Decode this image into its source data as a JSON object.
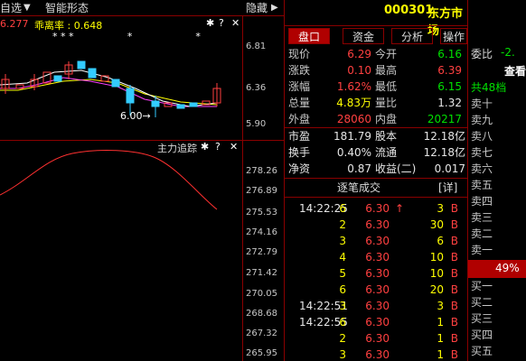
{
  "topbar": {
    "select_label": "自选",
    "stock_name_short": "智能形态",
    "hide_label": "隐藏",
    "ind_line": "6.277",
    "ind_name": "乖离率 : 0.648",
    "stars": "* * *                 *                    *",
    "btn_gear": "✱",
    "btn_help": "?",
    "btn_close": "✕"
  },
  "k_axis": {
    "t1": "6.81",
    "t2": "6.36",
    "t3": "5.90",
    "low_label": "6.00→"
  },
  "indicator": {
    "title": "主力追踪",
    "ticks": [
      "278.26",
      "276.89",
      "275.53",
      "274.16",
      "272.79",
      "271.42",
      "270.05",
      "268.68",
      "267.32",
      "265.95"
    ]
  },
  "header": {
    "code": "000301",
    "name": "东方市场"
  },
  "tabs": [
    "盘口",
    "资金",
    "分析",
    "操作"
  ],
  "quote": [
    {
      "l": "现价",
      "v": "6.29",
      "vc": "red",
      "l2": "今开",
      "v2": "6.16",
      "v2c": "green"
    },
    {
      "l": "涨跌",
      "v": "0.10",
      "vc": "red",
      "l2": "最高",
      "v2": "6.39",
      "v2c": "red"
    },
    {
      "l": "涨幅",
      "v": "1.62%",
      "vc": "red",
      "l2": "最低",
      "v2": "6.15",
      "v2c": "green"
    },
    {
      "l": "总量",
      "v": "4.83万",
      "vc": "yellow",
      "l2": "量比",
      "v2": "1.32",
      "v2c": "white"
    },
    {
      "l": "外盘",
      "v": "28060",
      "vc": "red",
      "l2": "内盘",
      "v2": "20217",
      "v2c": "green"
    }
  ],
  "quote2": [
    {
      "l": "市盈",
      "v": "181.79",
      "l2": "股本",
      "v2": "12.18亿"
    },
    {
      "l": "换手",
      "v": "0.40%",
      "l2": "流通",
      "v2": "12.18亿"
    },
    {
      "l": "净资",
      "v": "0.87",
      "l2": "收益(二)",
      "v2": "0.017"
    }
  ],
  "trades_header": {
    "title": "逐笔成交",
    "detail": "[详]"
  },
  "trades": [
    {
      "t": "14:22:25",
      "n": "6",
      "p": "6.30",
      "arrow": "↑",
      "v": "3",
      "bs": "B"
    },
    {
      "t": "",
      "n": "2",
      "p": "6.30",
      "arrow": "",
      "v": "30",
      "bs": "B"
    },
    {
      "t": "",
      "n": "3",
      "p": "6.30",
      "arrow": "",
      "v": "6",
      "bs": "B"
    },
    {
      "t": "",
      "n": "4",
      "p": "6.30",
      "arrow": "",
      "v": "10",
      "bs": "B"
    },
    {
      "t": "",
      "n": "5",
      "p": "6.30",
      "arrow": "",
      "v": "10",
      "bs": "B"
    },
    {
      "t": "",
      "n": "6",
      "p": "6.30",
      "arrow": "",
      "v": "20",
      "bs": "B"
    },
    {
      "t": "14:22:51",
      "n": "3",
      "p": "6.30",
      "arrow": "",
      "v": "3",
      "bs": "B"
    },
    {
      "t": "14:22:55",
      "n": "6",
      "p": "6.30",
      "arrow": "",
      "v": "1",
      "bs": "B"
    },
    {
      "t": "",
      "n": "2",
      "p": "6.30",
      "arrow": "",
      "v": "1",
      "bs": "B"
    },
    {
      "t": "",
      "n": "3",
      "p": "6.30",
      "arrow": "",
      "v": "1",
      "bs": "B"
    }
  ],
  "far": {
    "weibi_label": "委比",
    "weibi_val": "-2.",
    "view_btn": "查看",
    "total_label": "共48档",
    "sell": [
      "卖十",
      "卖九",
      "卖八",
      "卖七",
      "卖六",
      "卖五",
      "卖四",
      "卖三",
      "卖二",
      "卖一"
    ],
    "pct": "49%",
    "buy": [
      "买一",
      "买二",
      "买三",
      "买四",
      "买五"
    ]
  }
}
